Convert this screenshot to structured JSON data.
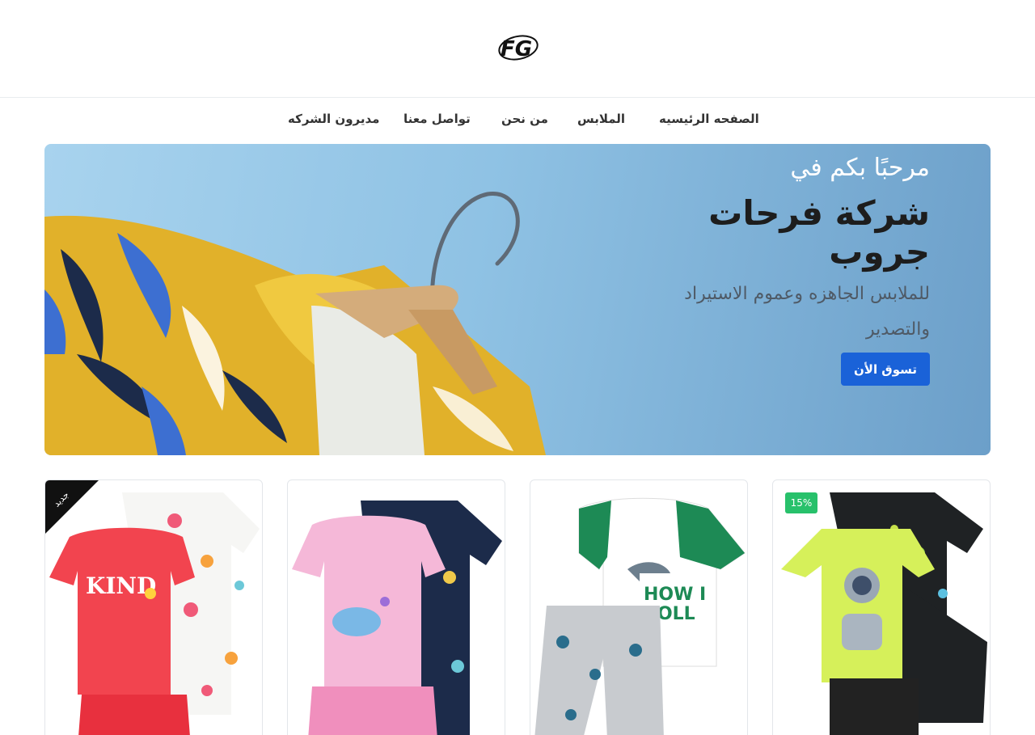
{
  "logo": {
    "text": "FG",
    "icon": "fg-logo"
  },
  "nav": {
    "items": [
      {
        "label": "الصفحه الرئيسيه"
      },
      {
        "label": "الملابس"
      },
      {
        "label": "من نحن"
      },
      {
        "label": "تواصل معنا"
      },
      {
        "label": "مديرون الشركه"
      }
    ]
  },
  "hero": {
    "welcome": "مرحبًا بكم في",
    "title": "شركة فرحات جروب",
    "subtitle": "للملابس الجاهزه وعموم الاستيراد والتصدير",
    "button": "تسوق الأن",
    "image": "yellow-tropical-shirt-on-wooden-hanger"
  },
  "products": [
    {
      "image": "kids-pajama-astronaut-set",
      "badge": "15%"
    },
    {
      "image": "kids-pajama-dinosaur-how-i-roll-set"
    },
    {
      "image": "kids-pajama-pink-fish-set"
    },
    {
      "image": "kids-pajama-kind-floral-set",
      "ribbon": "جديد"
    }
  ],
  "colors": {
    "accent": "#1a62d8",
    "discount_badge": "#28c16b",
    "new_ribbon": "#111111",
    "hero_background": "#8fc2e4"
  }
}
